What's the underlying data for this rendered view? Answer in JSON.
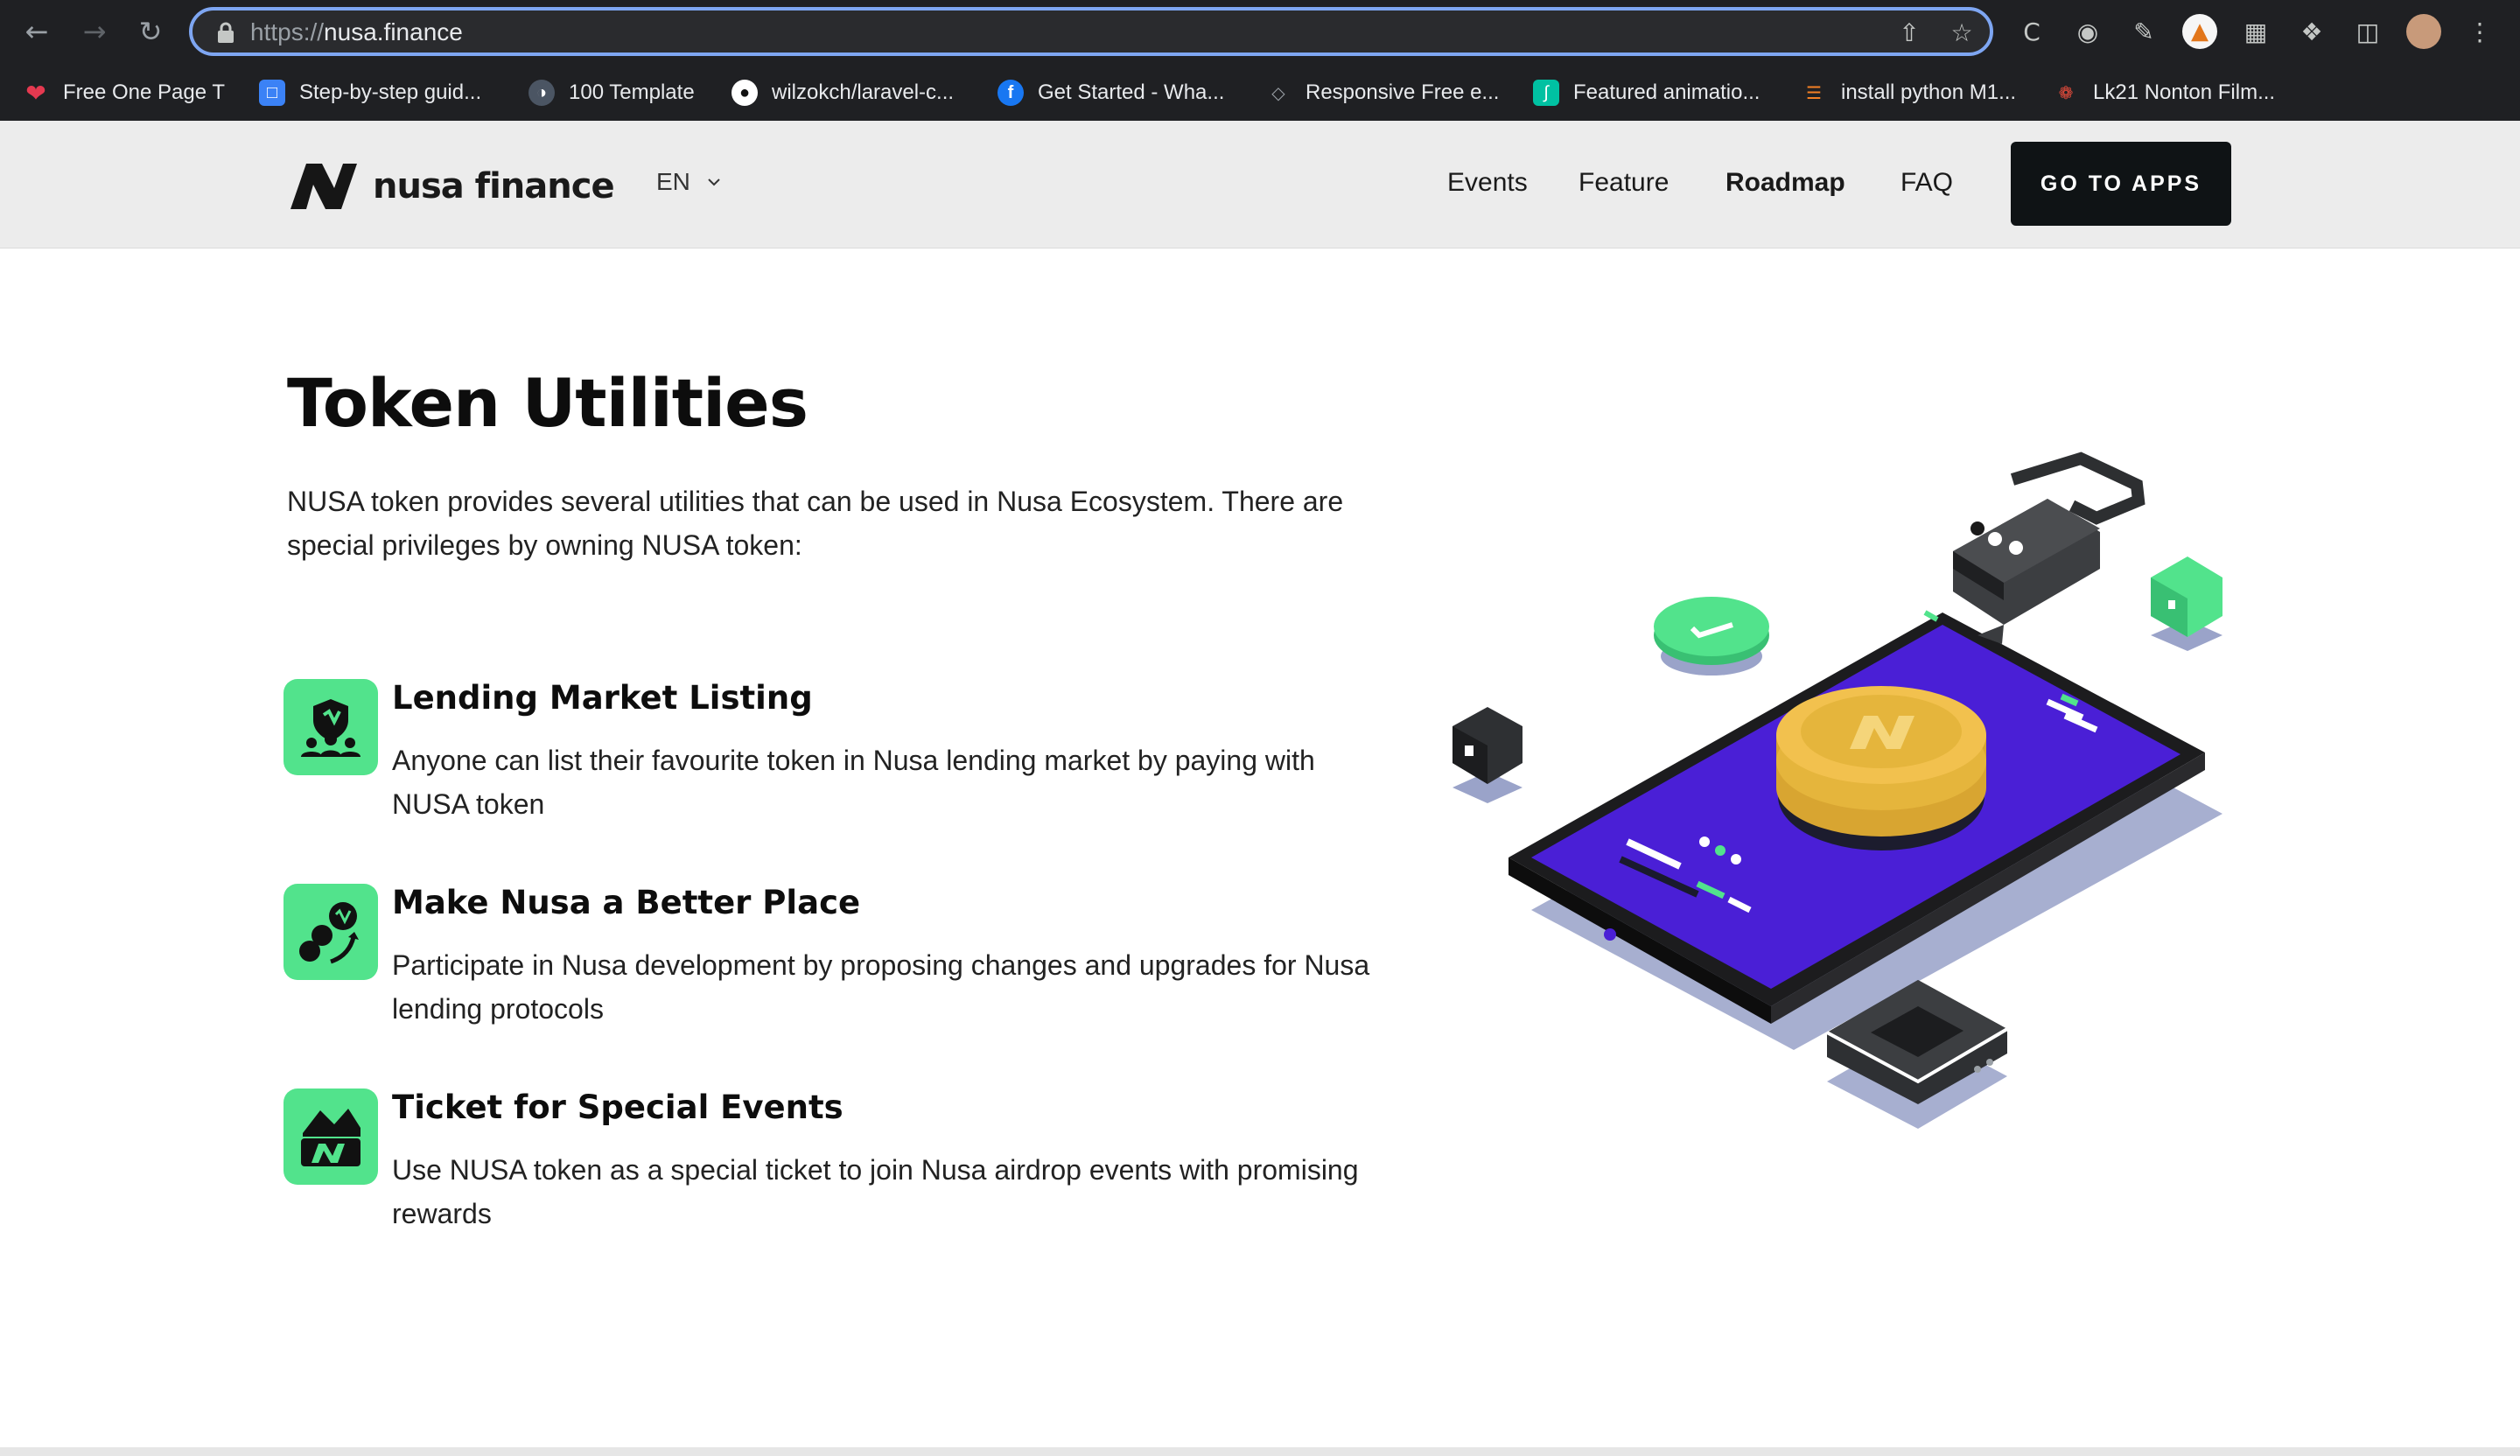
{
  "browser": {
    "url_scheme": "https://",
    "url_host": "nusa.finance",
    "bookmarks": [
      {
        "label": "Free One Page T",
        "icon": "heart-icon",
        "color": "#e53950"
      },
      {
        "label": "Step-by-step guid...",
        "icon": "page-icon",
        "color": "#3b82f6"
      },
      {
        "label": "100 Template",
        "icon": "globe-icon",
        "color": "#6b7280"
      },
      {
        "label": "wilzokch/laravel-c...",
        "icon": "github-icon",
        "color": "#ffffff"
      },
      {
        "label": "Get Started - Wha...",
        "icon": "facebook-icon",
        "color": "#1877f2"
      },
      {
        "label": "Responsive Free e...",
        "icon": "template-icon",
        "color": "#6b7280"
      },
      {
        "label": "Featured animatio...",
        "icon": "lottie-icon",
        "color": "#00c1a2"
      },
      {
        "label": "install python M1...",
        "icon": "stackoverflow-icon",
        "color": "#f48024"
      },
      {
        "label": "Lk21 Nonton Film...",
        "icon": "pinwheel-icon",
        "color": "#e74c3c"
      }
    ]
  },
  "header": {
    "logo_text": "nusa finance",
    "lang": "EN",
    "menu": [
      "Events",
      "Feature",
      "Roadmap",
      "FAQ"
    ],
    "active_menu": "Roadmap",
    "cta": "GO TO APPS"
  },
  "main": {
    "title": "Token Utilities",
    "intro": "NUSA token provides several utilities that can be used in Nusa Ecosystem. There are special privileges by owning NUSA token:",
    "features": [
      {
        "title": "Lending Market Listing",
        "desc": "Anyone can list their favourite token in Nusa lending market by paying with NUSA token",
        "icon": "lending-market-icon"
      },
      {
        "title": "Make Nusa a Better Place",
        "desc": "Participate in Nusa development by proposing changes and upgrades for Nusa lending protocols",
        "icon": "governance-icon"
      },
      {
        "title": "Ticket for Special Events",
        "desc": "Use NUSA token as a special ticket to join Nusa airdrop events with promising rewards",
        "icon": "ticket-icon"
      }
    ]
  },
  "colors": {
    "accent_green": "#52e38c",
    "purple": "#4a1fd6",
    "gold": "#f2c14e",
    "dark": "#0f1315"
  }
}
